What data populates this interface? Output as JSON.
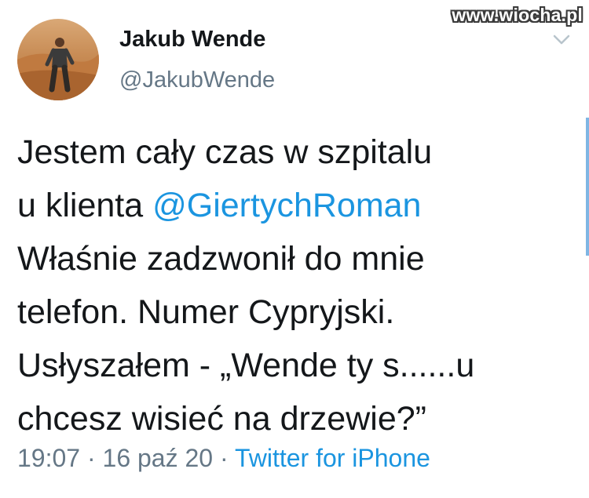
{
  "watermark": "www.wiocha.pl",
  "author": {
    "display_name": "Jakub Wende",
    "handle": "@JakubWende",
    "avatar_icon": "profile-avatar"
  },
  "tweet": {
    "line1": "Jestem cały czas w szpitalu",
    "line2_prefix": "u klienta ",
    "mention": "@GiertychRoman",
    "line3": "Właśnie zadzwonił do mnie",
    "line4": "telefon. Numer Cypryjski.",
    "line5": "Usłyszałem - „Wende ty s......u",
    "line6": "chcesz wisieć na drzewie?”"
  },
  "meta": {
    "time": "19:07",
    "separator": " · ",
    "date": "16 paź 20",
    "separator2": " · ",
    "source": "Twitter for iPhone"
  },
  "colors": {
    "link": "#1b95e0",
    "secondary_text": "#657786",
    "primary_text": "#14171a"
  }
}
